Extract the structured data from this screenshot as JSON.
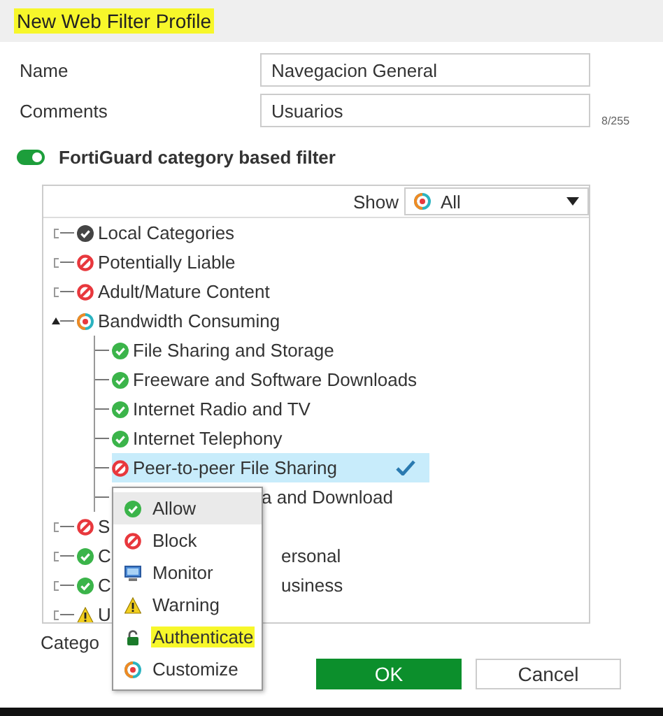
{
  "dialog": {
    "title": "New Web Filter Profile",
    "title_highlighted": true
  },
  "fields": [
    {
      "label": "Name",
      "value": "Navegacion General"
    },
    {
      "label": "Comments",
      "value": "Usuarios",
      "counter": "8/255"
    }
  ],
  "toggle": {
    "label": "FortiGuard category based filter",
    "on": true
  },
  "category_tree": {
    "show_label": "Show",
    "show_filter": {
      "value": "All",
      "kind": "customize"
    },
    "items": [
      {
        "label": "Local Categories",
        "kind": "local",
        "expanded": false,
        "selected": false
      },
      {
        "label": "Potentially Liable",
        "kind": "block",
        "expanded": false,
        "selected": false
      },
      {
        "label": "Adult/Mature Content",
        "kind": "block",
        "expanded": false,
        "selected": false
      },
      {
        "label": "Bandwidth Consuming",
        "kind": "customize",
        "expanded": true,
        "selected": false,
        "children": [
          {
            "label": "File Sharing and Storage",
            "kind": "allow",
            "selected": false
          },
          {
            "label": "Freeware and Software Downloads",
            "kind": "allow",
            "selected": false
          },
          {
            "label": "Internet Radio and TV",
            "kind": "allow",
            "selected": false
          },
          {
            "label": "Internet Telephony",
            "kind": "allow",
            "selected": false
          },
          {
            "label": "Peer-to-peer File Sharing",
            "kind": "block",
            "selected": true
          },
          {
            "label_tail": "a and Download",
            "selected": false
          }
        ]
      },
      {
        "label": "S",
        "kind": "block",
        "expanded": false,
        "selected": false
      },
      {
        "label": "C",
        "label_tail": "ersonal",
        "kind": "allow",
        "expanded": false,
        "selected": false
      },
      {
        "label": "C",
        "label_tail": "usiness",
        "kind": "allow",
        "expanded": false,
        "selected": false
      },
      {
        "label": "U",
        "kind": "warning",
        "expanded": false,
        "selected": false
      }
    ]
  },
  "footer_label": "Catego",
  "action_menu": {
    "items": [
      {
        "label": "Allow",
        "kind": "allow",
        "selected": true,
        "highlighted": false
      },
      {
        "label": "Block",
        "kind": "block",
        "selected": false,
        "highlighted": false
      },
      {
        "label": "Monitor",
        "kind": "monitor",
        "selected": false,
        "highlighted": false
      },
      {
        "label": "Warning",
        "kind": "warning",
        "selected": false,
        "highlighted": false
      },
      {
        "label": "Authenticate",
        "kind": "authenticate",
        "selected": false,
        "highlighted": true
      },
      {
        "label": "Customize",
        "kind": "customize",
        "selected": false,
        "highlighted": false
      }
    ]
  },
  "buttons": [
    {
      "label": "OK",
      "kind": "primary"
    },
    {
      "label": "Cancel",
      "kind": "secondary"
    }
  ]
}
